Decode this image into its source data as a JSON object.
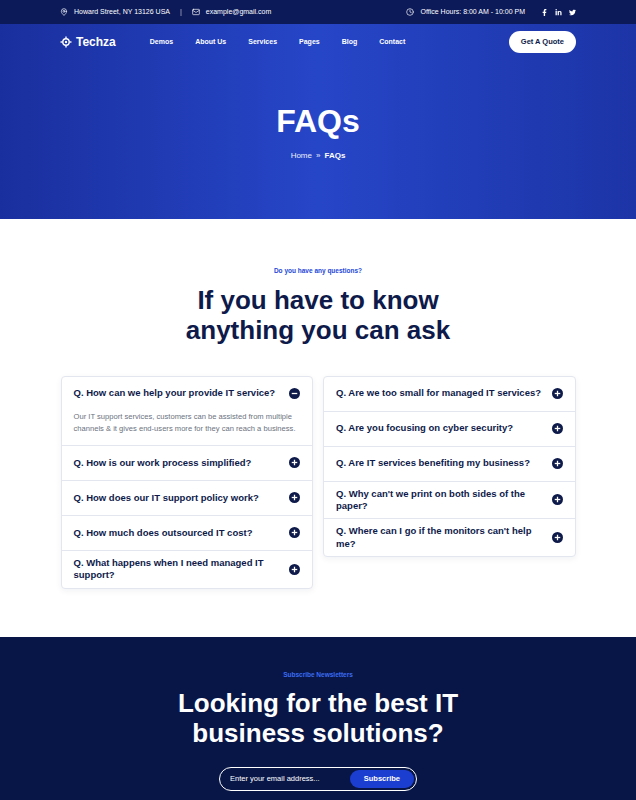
{
  "top_bar": {
    "address": "Howard Street, NY 13126 USA",
    "separator": "|",
    "email": "example@gmail.com",
    "hours": "Office Hours: 8:00 AM - 10:00 PM"
  },
  "header": {
    "logo": "Techza",
    "nav": [
      {
        "label": "Demos"
      },
      {
        "label": "About Us"
      },
      {
        "label": "Services"
      },
      {
        "label": "Pages"
      },
      {
        "label": "Blog"
      },
      {
        "label": "Contact"
      }
    ],
    "cta": "Get A Quote"
  },
  "hero": {
    "title": "FAQs",
    "breadcrumb": [
      {
        "label": "Home",
        "current": false
      },
      {
        "label": "»",
        "current": false
      },
      {
        "label": "FAQs",
        "current": true
      }
    ]
  },
  "faq": {
    "eyebrow": "Do you have any questions?",
    "heading": [
      "If you have to know",
      "anything you can ask"
    ],
    "columns": [
      [
        {
          "question": "Q. How can we help your provide IT service?",
          "expanded": true,
          "answer": "Our IT support services, customers can be assisted from multiple channels & it gives end-users more for they can reach a business."
        },
        {
          "question": "Q. How is our work process simplified?",
          "expanded": false,
          "answer": ""
        },
        {
          "question": "Q. How does our IT support policy work?",
          "expanded": false,
          "answer": ""
        },
        {
          "question": "Q. How much does outsourced IT cost?",
          "expanded": false,
          "answer": ""
        },
        {
          "question": "Q. What happens when I need managed IT support?",
          "expanded": false,
          "answer": ""
        }
      ],
      [
        {
          "question": "Q. Are we too small for managed IT services?",
          "expanded": false,
          "answer": ""
        },
        {
          "question": "Q. Are you focusing on cyber security?",
          "expanded": false,
          "answer": ""
        },
        {
          "question": "Q. Are IT services benefiting my business?",
          "expanded": false,
          "answer": ""
        },
        {
          "question": "Q. Why can't we print on both sides of the paper?",
          "expanded": false,
          "answer": ""
        },
        {
          "question": "Q. Where can I go if the monitors can't help me?",
          "expanded": false,
          "answer": ""
        }
      ]
    ]
  },
  "newsletter": {
    "eyebrow": "Subscribe Newsletters",
    "heading": [
      "Looking for the best IT",
      "business solutions?"
    ],
    "placeholder": "Enter your email address...",
    "button": "Subscribe"
  }
}
